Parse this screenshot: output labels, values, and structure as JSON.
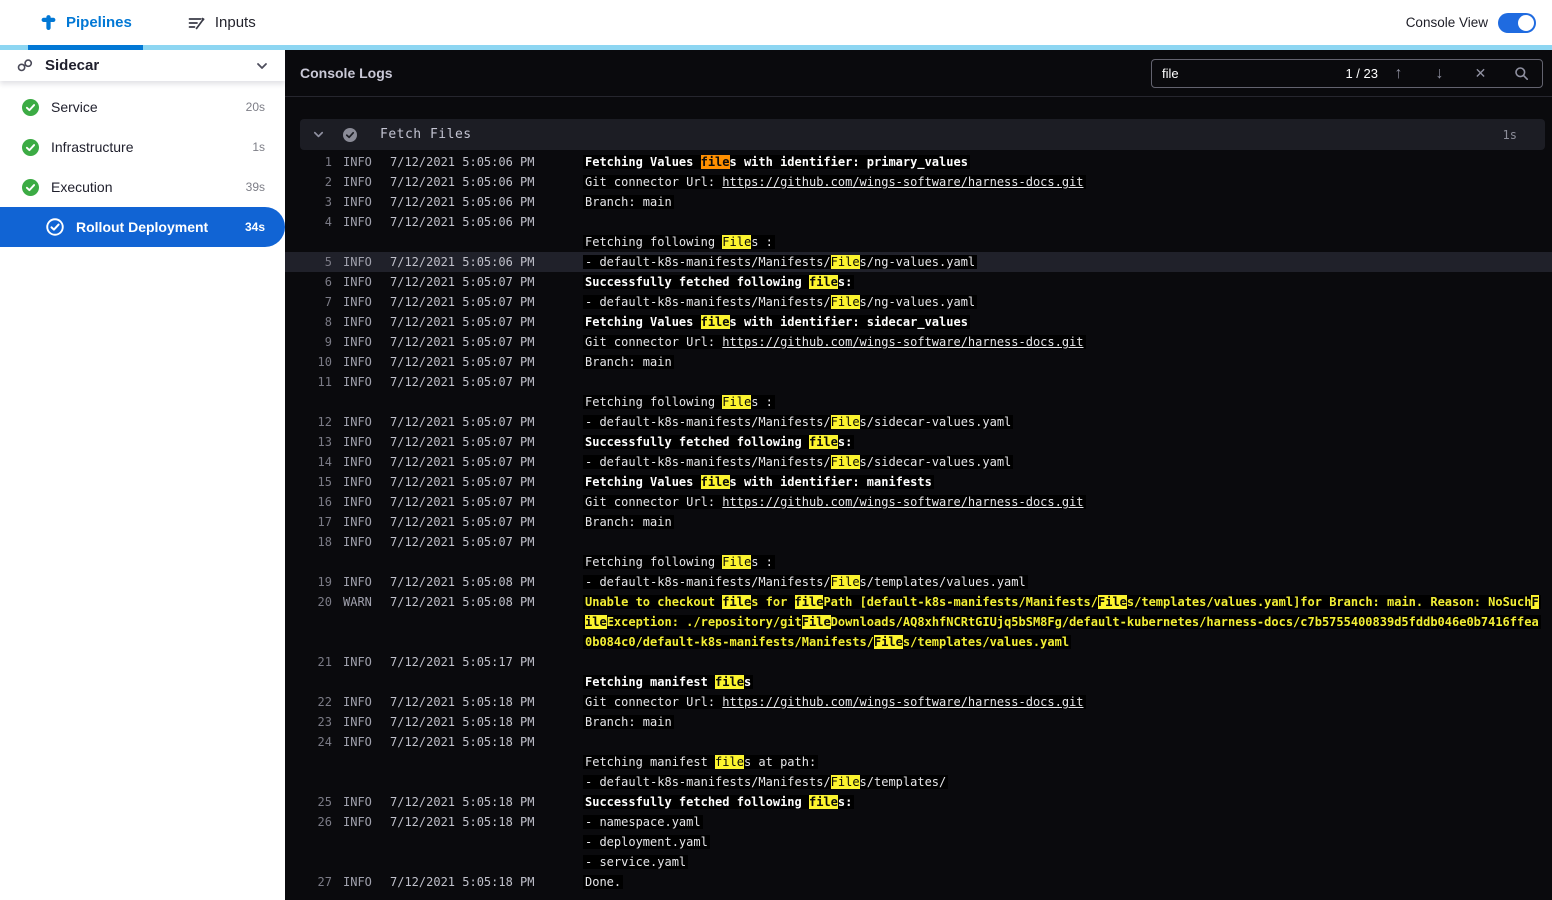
{
  "topbar": {
    "tabs": [
      {
        "label": "Pipelines"
      },
      {
        "label": "Inputs"
      }
    ],
    "console_view_label": "Console View",
    "toggle_on": true
  },
  "sidebar": {
    "stage": {
      "label": "Sidecar"
    },
    "items": [
      {
        "label": "Service",
        "duration": "20s",
        "status": "success",
        "selected": false
      },
      {
        "label": "Infrastructure",
        "duration": "1s",
        "status": "success",
        "selected": false
      },
      {
        "label": "Execution",
        "duration": "39s",
        "status": "success",
        "selected": false
      },
      {
        "label": "Rollout Deployment",
        "duration": "34s",
        "status": "success",
        "selected": true
      }
    ]
  },
  "console": {
    "title": "Console Logs",
    "search": {
      "value": "file",
      "counter": "1 / 23"
    },
    "section": {
      "title": "Fetch Files",
      "duration": "1s"
    },
    "colors": {
      "primary_blue": "#0278d5",
      "selected_blue": "#1164d4",
      "accent_cyan": "#8dd6f2",
      "success_green": "#3cab44",
      "match_yellow": "#fcf42e",
      "match_current_orange": "#ff8f00",
      "warn_yellow": "#f2ee35"
    },
    "entries": [
      {
        "n": 1,
        "level": "INFO",
        "ts": "7/12/2021 5:05:06 PM",
        "lines": [
          {
            "b": 1,
            "segs": [
              {
                "t": "Fetching Values "
              },
              {
                "t": "file",
                "hl": "cur"
              },
              {
                "t": "s with identifier: primary_values"
              }
            ]
          }
        ]
      },
      {
        "n": 2,
        "level": "INFO",
        "ts": "7/12/2021 5:05:06 PM",
        "lines": [
          {
            "segs": [
              {
                "t": "Git connector Url: "
              },
              {
                "t": "https://github.com/wings-software/harness-docs.git",
                "link": 1
              }
            ]
          }
        ]
      },
      {
        "n": 3,
        "level": "INFO",
        "ts": "7/12/2021 5:05:06 PM",
        "lines": [
          {
            "segs": [
              {
                "t": "Branch: main"
              }
            ]
          }
        ]
      },
      {
        "n": 4,
        "level": "INFO",
        "ts": "7/12/2021 5:05:06 PM",
        "lines": [
          {
            "empty": 1
          },
          {
            "segs": [
              {
                "t": "Fetching following "
              },
              {
                "t": "File",
                "hl": 1
              },
              {
                "t": "s :"
              }
            ]
          }
        ]
      },
      {
        "n": 5,
        "level": "INFO",
        "ts": "7/12/2021 5:05:06 PM",
        "active": 1,
        "lines": [
          {
            "segs": [
              {
                "t": "- default-k8s-manifests/Manifests/"
              },
              {
                "t": "File",
                "hl": 1
              },
              {
                "t": "s/ng-values.yaml"
              }
            ]
          }
        ]
      },
      {
        "n": 6,
        "level": "INFO",
        "ts": "7/12/2021 5:05:07 PM",
        "lines": [
          {
            "b": 1,
            "segs": [
              {
                "t": "Successfully fetched following "
              },
              {
                "t": "file",
                "hl": 1
              },
              {
                "t": "s:"
              }
            ]
          }
        ]
      },
      {
        "n": 7,
        "level": "INFO",
        "ts": "7/12/2021 5:05:07 PM",
        "lines": [
          {
            "segs": [
              {
                "t": "- default-k8s-manifests/Manifests/"
              },
              {
                "t": "File",
                "hl": 1
              },
              {
                "t": "s/ng-values.yaml"
              }
            ]
          }
        ]
      },
      {
        "n": 8,
        "level": "INFO",
        "ts": "7/12/2021 5:05:07 PM",
        "lines": [
          {
            "b": 1,
            "segs": [
              {
                "t": "Fetching Values "
              },
              {
                "t": "file",
                "hl": 1
              },
              {
                "t": "s with identifier: sidecar_values"
              }
            ]
          }
        ]
      },
      {
        "n": 9,
        "level": "INFO",
        "ts": "7/12/2021 5:05:07 PM",
        "lines": [
          {
            "segs": [
              {
                "t": "Git connector Url: "
              },
              {
                "t": "https://github.com/wings-software/harness-docs.git",
                "link": 1
              }
            ]
          }
        ]
      },
      {
        "n": 10,
        "level": "INFO",
        "ts": "7/12/2021 5:05:07 PM",
        "lines": [
          {
            "segs": [
              {
                "t": "Branch: main"
              }
            ]
          }
        ]
      },
      {
        "n": 11,
        "level": "INFO",
        "ts": "7/12/2021 5:05:07 PM",
        "lines": [
          {
            "empty": 1
          },
          {
            "segs": [
              {
                "t": "Fetching following "
              },
              {
                "t": "File",
                "hl": 1
              },
              {
                "t": "s :"
              }
            ]
          }
        ]
      },
      {
        "n": 12,
        "level": "INFO",
        "ts": "7/12/2021 5:05:07 PM",
        "lines": [
          {
            "segs": [
              {
                "t": "- default-k8s-manifests/Manifests/"
              },
              {
                "t": "File",
                "hl": 1
              },
              {
                "t": "s/sidecar-values.yaml"
              }
            ]
          }
        ]
      },
      {
        "n": 13,
        "level": "INFO",
        "ts": "7/12/2021 5:05:07 PM",
        "lines": [
          {
            "b": 1,
            "segs": [
              {
                "t": "Successfully fetched following "
              },
              {
                "t": "file",
                "hl": 1
              },
              {
                "t": "s:"
              }
            ]
          }
        ]
      },
      {
        "n": 14,
        "level": "INFO",
        "ts": "7/12/2021 5:05:07 PM",
        "lines": [
          {
            "segs": [
              {
                "t": "- default-k8s-manifests/Manifests/"
              },
              {
                "t": "File",
                "hl": 1
              },
              {
                "t": "s/sidecar-values.yaml"
              }
            ]
          }
        ]
      },
      {
        "n": 15,
        "level": "INFO",
        "ts": "7/12/2021 5:05:07 PM",
        "lines": [
          {
            "b": 1,
            "segs": [
              {
                "t": "Fetching Values "
              },
              {
                "t": "file",
                "hl": 1
              },
              {
                "t": "s with identifier: manifests"
              }
            ]
          }
        ]
      },
      {
        "n": 16,
        "level": "INFO",
        "ts": "7/12/2021 5:05:07 PM",
        "lines": [
          {
            "segs": [
              {
                "t": "Git connector Url: "
              },
              {
                "t": "https://github.com/wings-software/harness-docs.git",
                "link": 1
              }
            ]
          }
        ]
      },
      {
        "n": 17,
        "level": "INFO",
        "ts": "7/12/2021 5:05:07 PM",
        "lines": [
          {
            "segs": [
              {
                "t": "Branch: main"
              }
            ]
          }
        ]
      },
      {
        "n": 18,
        "level": "INFO",
        "ts": "7/12/2021 5:05:07 PM",
        "lines": [
          {
            "empty": 1
          },
          {
            "segs": [
              {
                "t": "Fetching following "
              },
              {
                "t": "File",
                "hl": 1
              },
              {
                "t": "s :"
              }
            ]
          }
        ]
      },
      {
        "n": 19,
        "level": "INFO",
        "ts": "7/12/2021 5:05:08 PM",
        "lines": [
          {
            "segs": [
              {
                "t": "- default-k8s-manifests/Manifests/"
              },
              {
                "t": "File",
                "hl": 1
              },
              {
                "t": "s/templates/values.yaml"
              }
            ]
          }
        ]
      },
      {
        "n": 20,
        "level": "WARN",
        "ts": "7/12/2021 5:05:08 PM",
        "lines": [
          {
            "b": 1,
            "warn": 1,
            "segs": [
              {
                "t": "Unable to checkout "
              },
              {
                "t": "file",
                "hl": 1
              },
              {
                "t": "s for "
              },
              {
                "t": "file",
                "hl": 1
              },
              {
                "t": "Path [default-k8s-manifests/Manifests/"
              },
              {
                "t": "File",
                "hl": 1
              },
              {
                "t": "s/templates/values.yaml]for Branch: main. Reason: NoSuch"
              },
              {
                "t": "F",
                "hl": 1
              }
            ]
          },
          {
            "b": 1,
            "warn": 1,
            "segs": [
              {
                "t": "ile",
                "hl": 1
              },
              {
                "t": "Exception: ./repository/git"
              },
              {
                "t": "File",
                "hl": 1
              },
              {
                "t": "Downloads/AQ8xhfNCRtGIUjq5bSM8Fg/default-kubernetes/harness-docs/c7b5755400839d5fddb046e0b7416ffea"
              }
            ]
          },
          {
            "b": 1,
            "warn": 1,
            "segs": [
              {
                "t": "0b084c0/default-k8s-manifests/Manifests/"
              },
              {
                "t": "File",
                "hl": 1
              },
              {
                "t": "s/templates/values.yaml"
              }
            ]
          }
        ]
      },
      {
        "n": 21,
        "level": "INFO",
        "ts": "7/12/2021 5:05:17 PM",
        "lines": [
          {
            "empty": 1
          },
          {
            "b": 1,
            "segs": [
              {
                "t": "Fetching manifest "
              },
              {
                "t": "file",
                "hl": 1
              },
              {
                "t": "s"
              }
            ]
          }
        ]
      },
      {
        "n": 22,
        "level": "INFO",
        "ts": "7/12/2021 5:05:18 PM",
        "lines": [
          {
            "segs": [
              {
                "t": "Git connector Url: "
              },
              {
                "t": "https://github.com/wings-software/harness-docs.git",
                "link": 1
              }
            ]
          }
        ]
      },
      {
        "n": 23,
        "level": "INFO",
        "ts": "7/12/2021 5:05:18 PM",
        "lines": [
          {
            "segs": [
              {
                "t": "Branch: main"
              }
            ]
          }
        ]
      },
      {
        "n": 24,
        "level": "INFO",
        "ts": "7/12/2021 5:05:18 PM",
        "lines": [
          {
            "empty": 1
          },
          {
            "segs": [
              {
                "t": "Fetching manifest "
              },
              {
                "t": "file",
                "hl": 1
              },
              {
                "t": "s at path:"
              }
            ]
          },
          {
            "segs": [
              {
                "t": "- default-k8s-manifests/Manifests/"
              },
              {
                "t": "File",
                "hl": 1
              },
              {
                "t": "s/templates/"
              }
            ]
          }
        ]
      },
      {
        "n": 25,
        "level": "INFO",
        "ts": "7/12/2021 5:05:18 PM",
        "lines": [
          {
            "b": 1,
            "segs": [
              {
                "t": "Successfully fetched following "
              },
              {
                "t": "file",
                "hl": 1
              },
              {
                "t": "s:"
              }
            ]
          }
        ]
      },
      {
        "n": 26,
        "level": "INFO",
        "ts": "7/12/2021 5:05:18 PM",
        "lines": [
          {
            "segs": [
              {
                "t": "- namespace.yaml"
              }
            ]
          },
          {
            "segs": [
              {
                "t": "- deployment.yaml"
              }
            ]
          },
          {
            "segs": [
              {
                "t": "- service.yaml"
              }
            ]
          }
        ]
      },
      {
        "n": 27,
        "level": "INFO",
        "ts": "7/12/2021 5:05:18 PM",
        "lines": [
          {
            "segs": [
              {
                "t": "Done."
              }
            ]
          }
        ]
      }
    ]
  }
}
